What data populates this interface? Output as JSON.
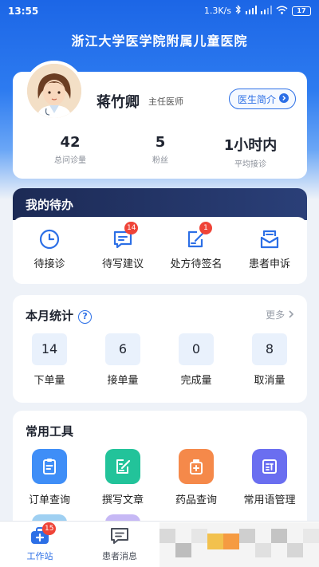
{
  "status_bar": {
    "time": "13:55",
    "speed": "1.3K/s",
    "battery": "17"
  },
  "hospital_name": "浙江大学医学院附属儿童医院",
  "doctor": {
    "name": "蒋竹卿",
    "title": "主任医师",
    "intro_button": "医生简介",
    "stats": [
      {
        "value": "42",
        "label": "总问诊量"
      },
      {
        "value": "5",
        "label": "粉丝"
      },
      {
        "value": "1小时内",
        "label": "平均接诊"
      }
    ]
  },
  "todo": {
    "title": "我的待办",
    "items": [
      {
        "label": "待接诊",
        "icon": "clock-icon",
        "badge": ""
      },
      {
        "label": "待写建议",
        "icon": "chat-edit-icon",
        "badge": "14"
      },
      {
        "label": "处方待签名",
        "icon": "sign-icon",
        "badge": "1"
      },
      {
        "label": "患者申诉",
        "icon": "inbox-icon",
        "badge": ""
      }
    ]
  },
  "monthly": {
    "title": "本月统计",
    "help": "?",
    "more": "更多",
    "items": [
      {
        "value": "14",
        "label": "下单量"
      },
      {
        "value": "6",
        "label": "接单量"
      },
      {
        "value": "0",
        "label": "完成量"
      },
      {
        "value": "8",
        "label": "取消量"
      }
    ]
  },
  "tools": {
    "title": "常用工具",
    "items": [
      {
        "label": "订单查询",
        "icon": "clipboard-icon",
        "color": "#3f8ef7"
      },
      {
        "label": "撰写文章",
        "icon": "write-icon",
        "color": "#22c39a"
      },
      {
        "label": "药品查询",
        "icon": "medicine-icon",
        "color": "#f5894a"
      },
      {
        "label": "常用语管理",
        "icon": "phrase-icon",
        "color": "#6a6ef0"
      }
    ]
  },
  "tabbar": {
    "items": [
      {
        "label": "工作站",
        "badge": "15",
        "active": true
      },
      {
        "label": "患者消息",
        "badge": "",
        "active": false
      }
    ]
  },
  "colors": {
    "primary": "#2c6fe6",
    "badge": "#ef4438",
    "todo_header": "#1c2a55"
  }
}
